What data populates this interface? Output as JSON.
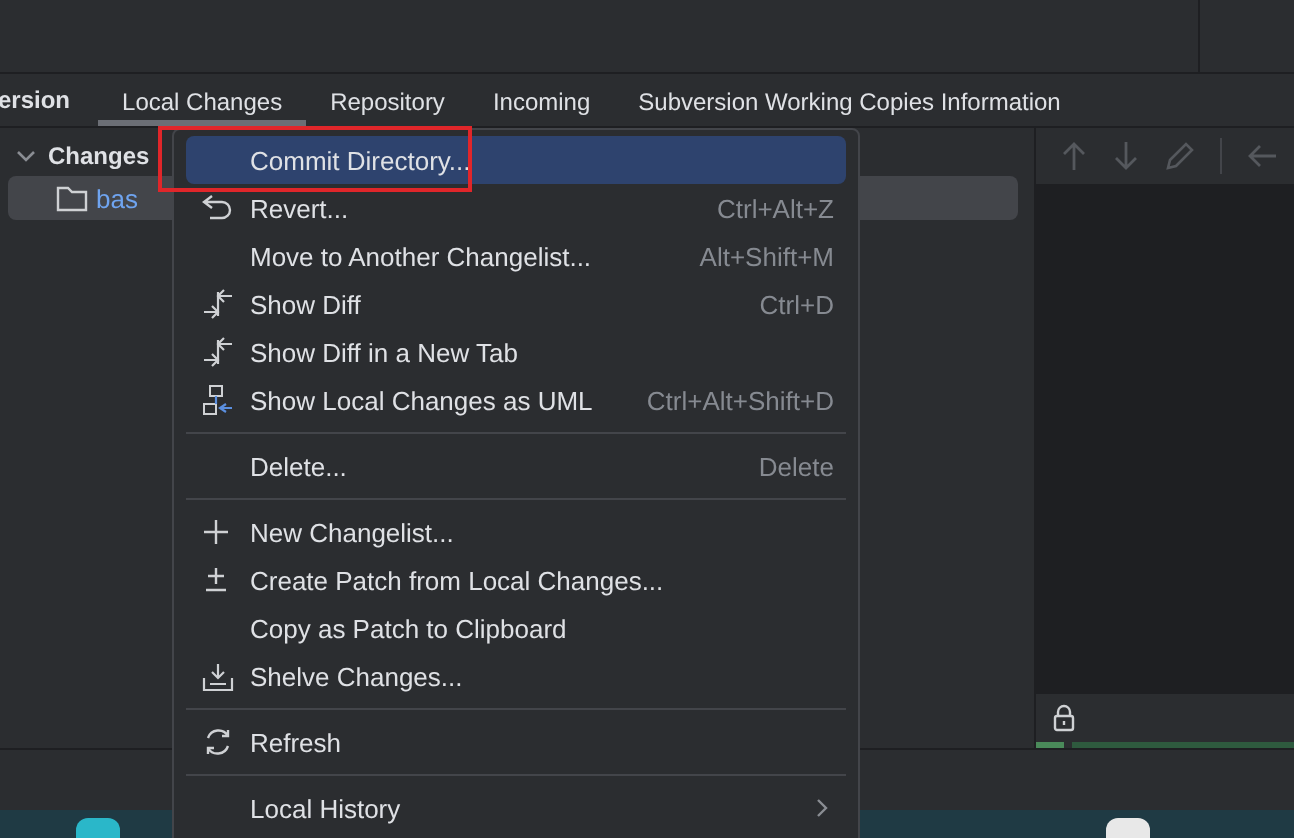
{
  "tabs": [
    {
      "label": "ersion",
      "kind": "title"
    },
    {
      "label": "Local Changes",
      "selected": true,
      "kind": "tab"
    },
    {
      "label": "Repository",
      "selected": false,
      "kind": "tab"
    },
    {
      "label": "Incoming",
      "selected": false,
      "kind": "tab"
    },
    {
      "label": "Subversion Working Copies Information",
      "selected": false,
      "kind": "tab"
    }
  ],
  "tree": {
    "label": "Changes",
    "expanded": true,
    "children": [
      {
        "label": "bas",
        "selected": true
      }
    ]
  },
  "context_menu": {
    "items": [
      {
        "kind": "item",
        "label": "Commit Directory...",
        "selected": true,
        "outlined": true
      },
      {
        "kind": "item",
        "label": "Revert...",
        "shortcut": "Ctrl+Alt+Z",
        "selected": false,
        "outlined": false
      },
      {
        "kind": "item",
        "label": "Move to Another Changelist...",
        "shortcut": "Alt+Shift+M",
        "selected": false,
        "outlined": false
      },
      {
        "kind": "item",
        "label": "Show Diff",
        "shortcut": "Ctrl+D",
        "selected": false,
        "outlined": false
      },
      {
        "kind": "item",
        "label": "Show Diff in a New Tab",
        "selected": false,
        "outlined": false
      },
      {
        "kind": "item",
        "label": "Show Local Changes as UML",
        "shortcut": "Ctrl+Alt+Shift+D",
        "selected": false,
        "outlined": false
      },
      {
        "kind": "separator"
      },
      {
        "kind": "item",
        "label": "Delete...",
        "shortcut": "Delete",
        "selected": false,
        "outlined": false
      },
      {
        "kind": "separator"
      },
      {
        "kind": "item",
        "label": "New Changelist...",
        "selected": false,
        "outlined": false
      },
      {
        "kind": "item",
        "label": "Create Patch from Local Changes...",
        "selected": false,
        "outlined": false
      },
      {
        "kind": "item",
        "label": "Copy as Patch to Clipboard",
        "selected": false,
        "outlined": false
      },
      {
        "kind": "item",
        "label": "Shelve Changes...",
        "selected": false,
        "outlined": false
      },
      {
        "kind": "separator"
      },
      {
        "kind": "item",
        "label": "Refresh",
        "selected": false,
        "outlined": false
      },
      {
        "kind": "separator"
      },
      {
        "kind": "submenu",
        "label": "Local History",
        "selected": false,
        "outlined": false
      }
    ]
  }
}
